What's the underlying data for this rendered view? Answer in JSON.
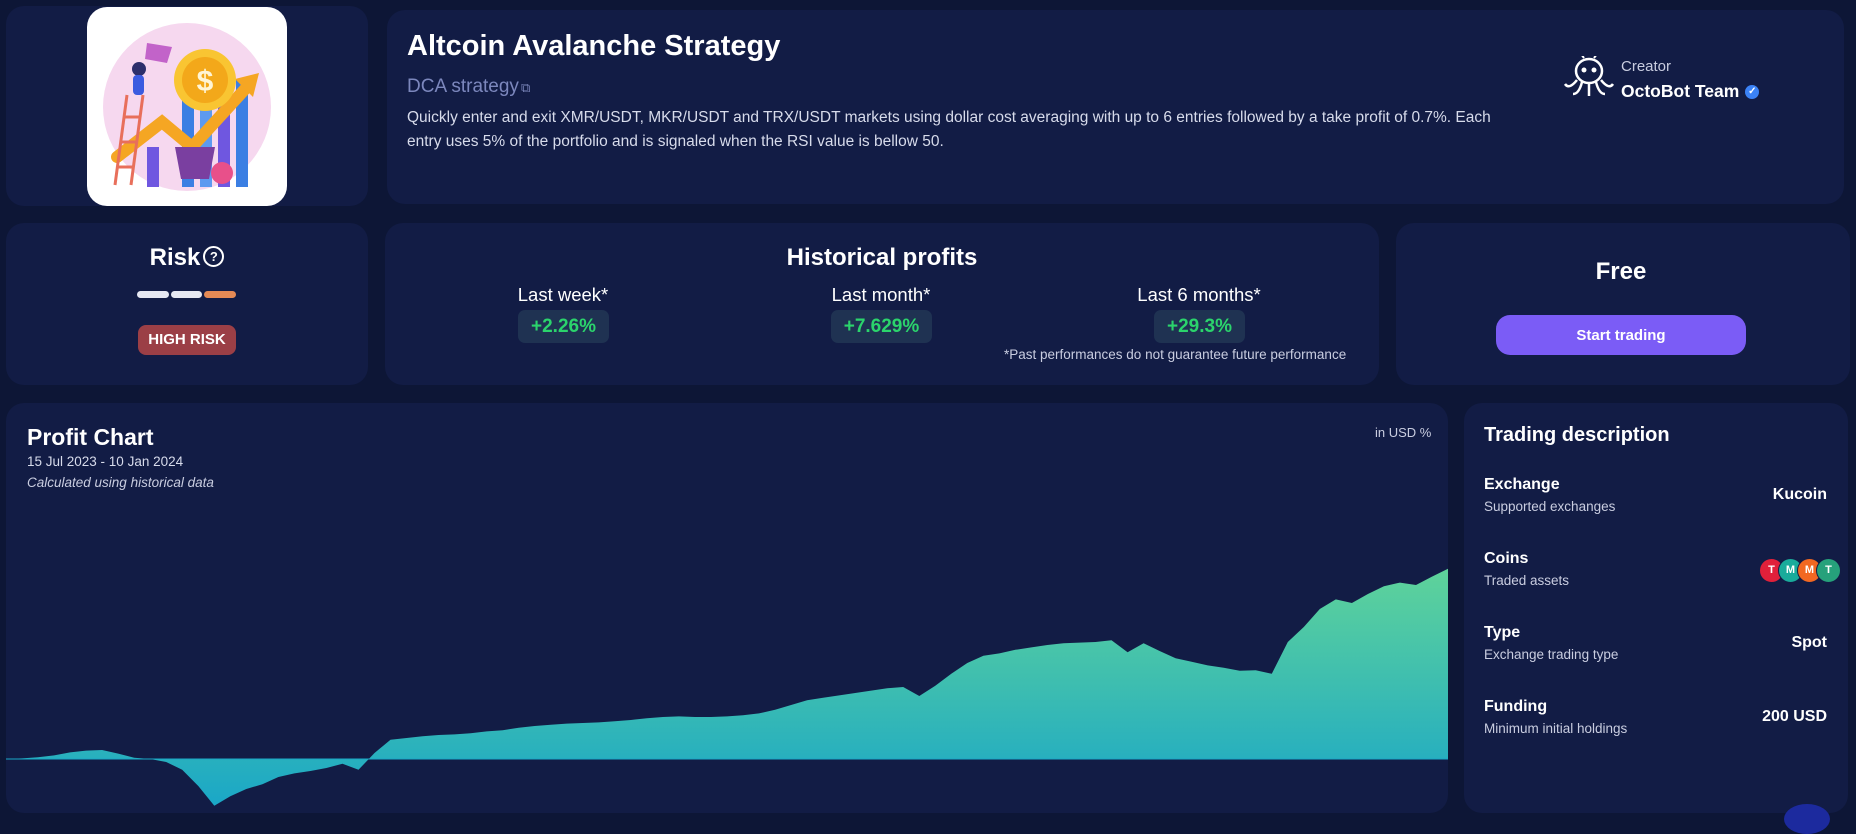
{
  "strategy": {
    "title": "Altcoin Avalanche Strategy",
    "subtitle": "DCA strategy",
    "description": "Quickly enter and exit XMR/USDT, MKR/USDT and TRX/USDT markets using dollar cost averaging with up to 6 entries followed by a take profit of 0.7%. Each entry uses 5% of the portfolio and is signaled when the RSI value is bellow 50.",
    "external_link_icon": "external-link-icon"
  },
  "creator": {
    "label": "Creator",
    "name": "OctoBot Team",
    "logo_icon": "octobot-logo-icon",
    "verified_icon": "verified-check-icon"
  },
  "risk": {
    "title": "Risk",
    "help_icon": "question-circle-icon",
    "badge": "HIGH RISK",
    "level": 3,
    "max_level": 3,
    "colors": [
      "#e6e8f2",
      "#e6e8f2",
      "#e58a55"
    ]
  },
  "historical_profits": {
    "title": "Historical profits",
    "periods": [
      {
        "label": "Last week*",
        "value": "+2.26%"
      },
      {
        "label": "Last month*",
        "value": "+7.629%"
      },
      {
        "label": "Last 6 months*",
        "value": "+29.3%"
      }
    ],
    "disclaimer": "*Past performances do not guarantee future performance"
  },
  "pricing": {
    "label": "Free",
    "button": "Start trading",
    "accent": "#7b5cf6"
  },
  "profit_chart": {
    "title": "Profit Chart",
    "dates": "15 Jul 2023 - 10 Jan 2024",
    "note": "Calculated using historical data",
    "unit": "in USD %"
  },
  "chart_data": {
    "type": "area",
    "x_start": "15 Jul 2023",
    "x_end": "10 Jan 2024",
    "y_unit": "%",
    "gradient_top": "#5fd39a",
    "gradient_bottom": "#1aa7c7",
    "series": [
      {
        "values": [
          0,
          0.1,
          0.3,
          0.6,
          1.1,
          1.4,
          1.5,
          0.9,
          0.2,
          0,
          -0.5,
          -1.8,
          -4.5,
          -7.8,
          -6.2,
          -5.0,
          -4.2,
          -3.0,
          -2.4,
          -2.0,
          -1.5,
          -0.8,
          -1.8,
          1.0,
          3.2,
          3.5,
          3.8,
          4.0,
          4.1,
          4.3,
          4.6,
          4.8,
          5.2,
          5.5,
          5.7,
          5.9,
          6.0,
          6.1,
          6.3,
          6.5,
          6.8,
          7.0,
          7.1,
          7.0,
          7.0,
          7.1,
          7.3,
          7.6,
          8.2,
          9.0,
          9.8,
          10.2,
          10.6,
          11.0,
          11.4,
          11.8,
          12.0,
          10.5,
          12.2,
          14.2,
          16.0,
          17.2,
          17.6,
          18.2,
          18.6,
          19.0,
          19.3,
          19.4,
          19.5,
          19.8,
          17.8,
          19.3,
          18.0,
          16.8,
          16.2,
          15.6,
          15.2,
          14.7,
          14.8,
          14.2,
          19.5,
          22.0,
          25.0,
          26.6,
          26.0,
          27.5,
          28.8,
          29.4,
          29.0,
          30.4,
          31.7
        ]
      }
    ]
  },
  "trading_description": {
    "title": "Trading description",
    "rows": [
      {
        "label": "Exchange",
        "sub": "Supported exchanges",
        "value": "Kucoin"
      },
      {
        "label": "Coins",
        "sub": "Traded assets",
        "value": ""
      },
      {
        "label": "Type",
        "sub": "Exchange trading type",
        "value": "Spot"
      },
      {
        "label": "Funding",
        "sub": "Minimum initial holdings",
        "value": "200 USD"
      }
    ],
    "coins": [
      {
        "symbol": "T",
        "name": "tron-icon",
        "color": "#e0203a"
      },
      {
        "symbol": "M",
        "name": "maker-icon",
        "color": "#1aab9b"
      },
      {
        "symbol": "M",
        "name": "monero-icon",
        "color": "#f26822"
      },
      {
        "symbol": "T",
        "name": "tether-icon",
        "color": "#26a17b"
      }
    ]
  }
}
